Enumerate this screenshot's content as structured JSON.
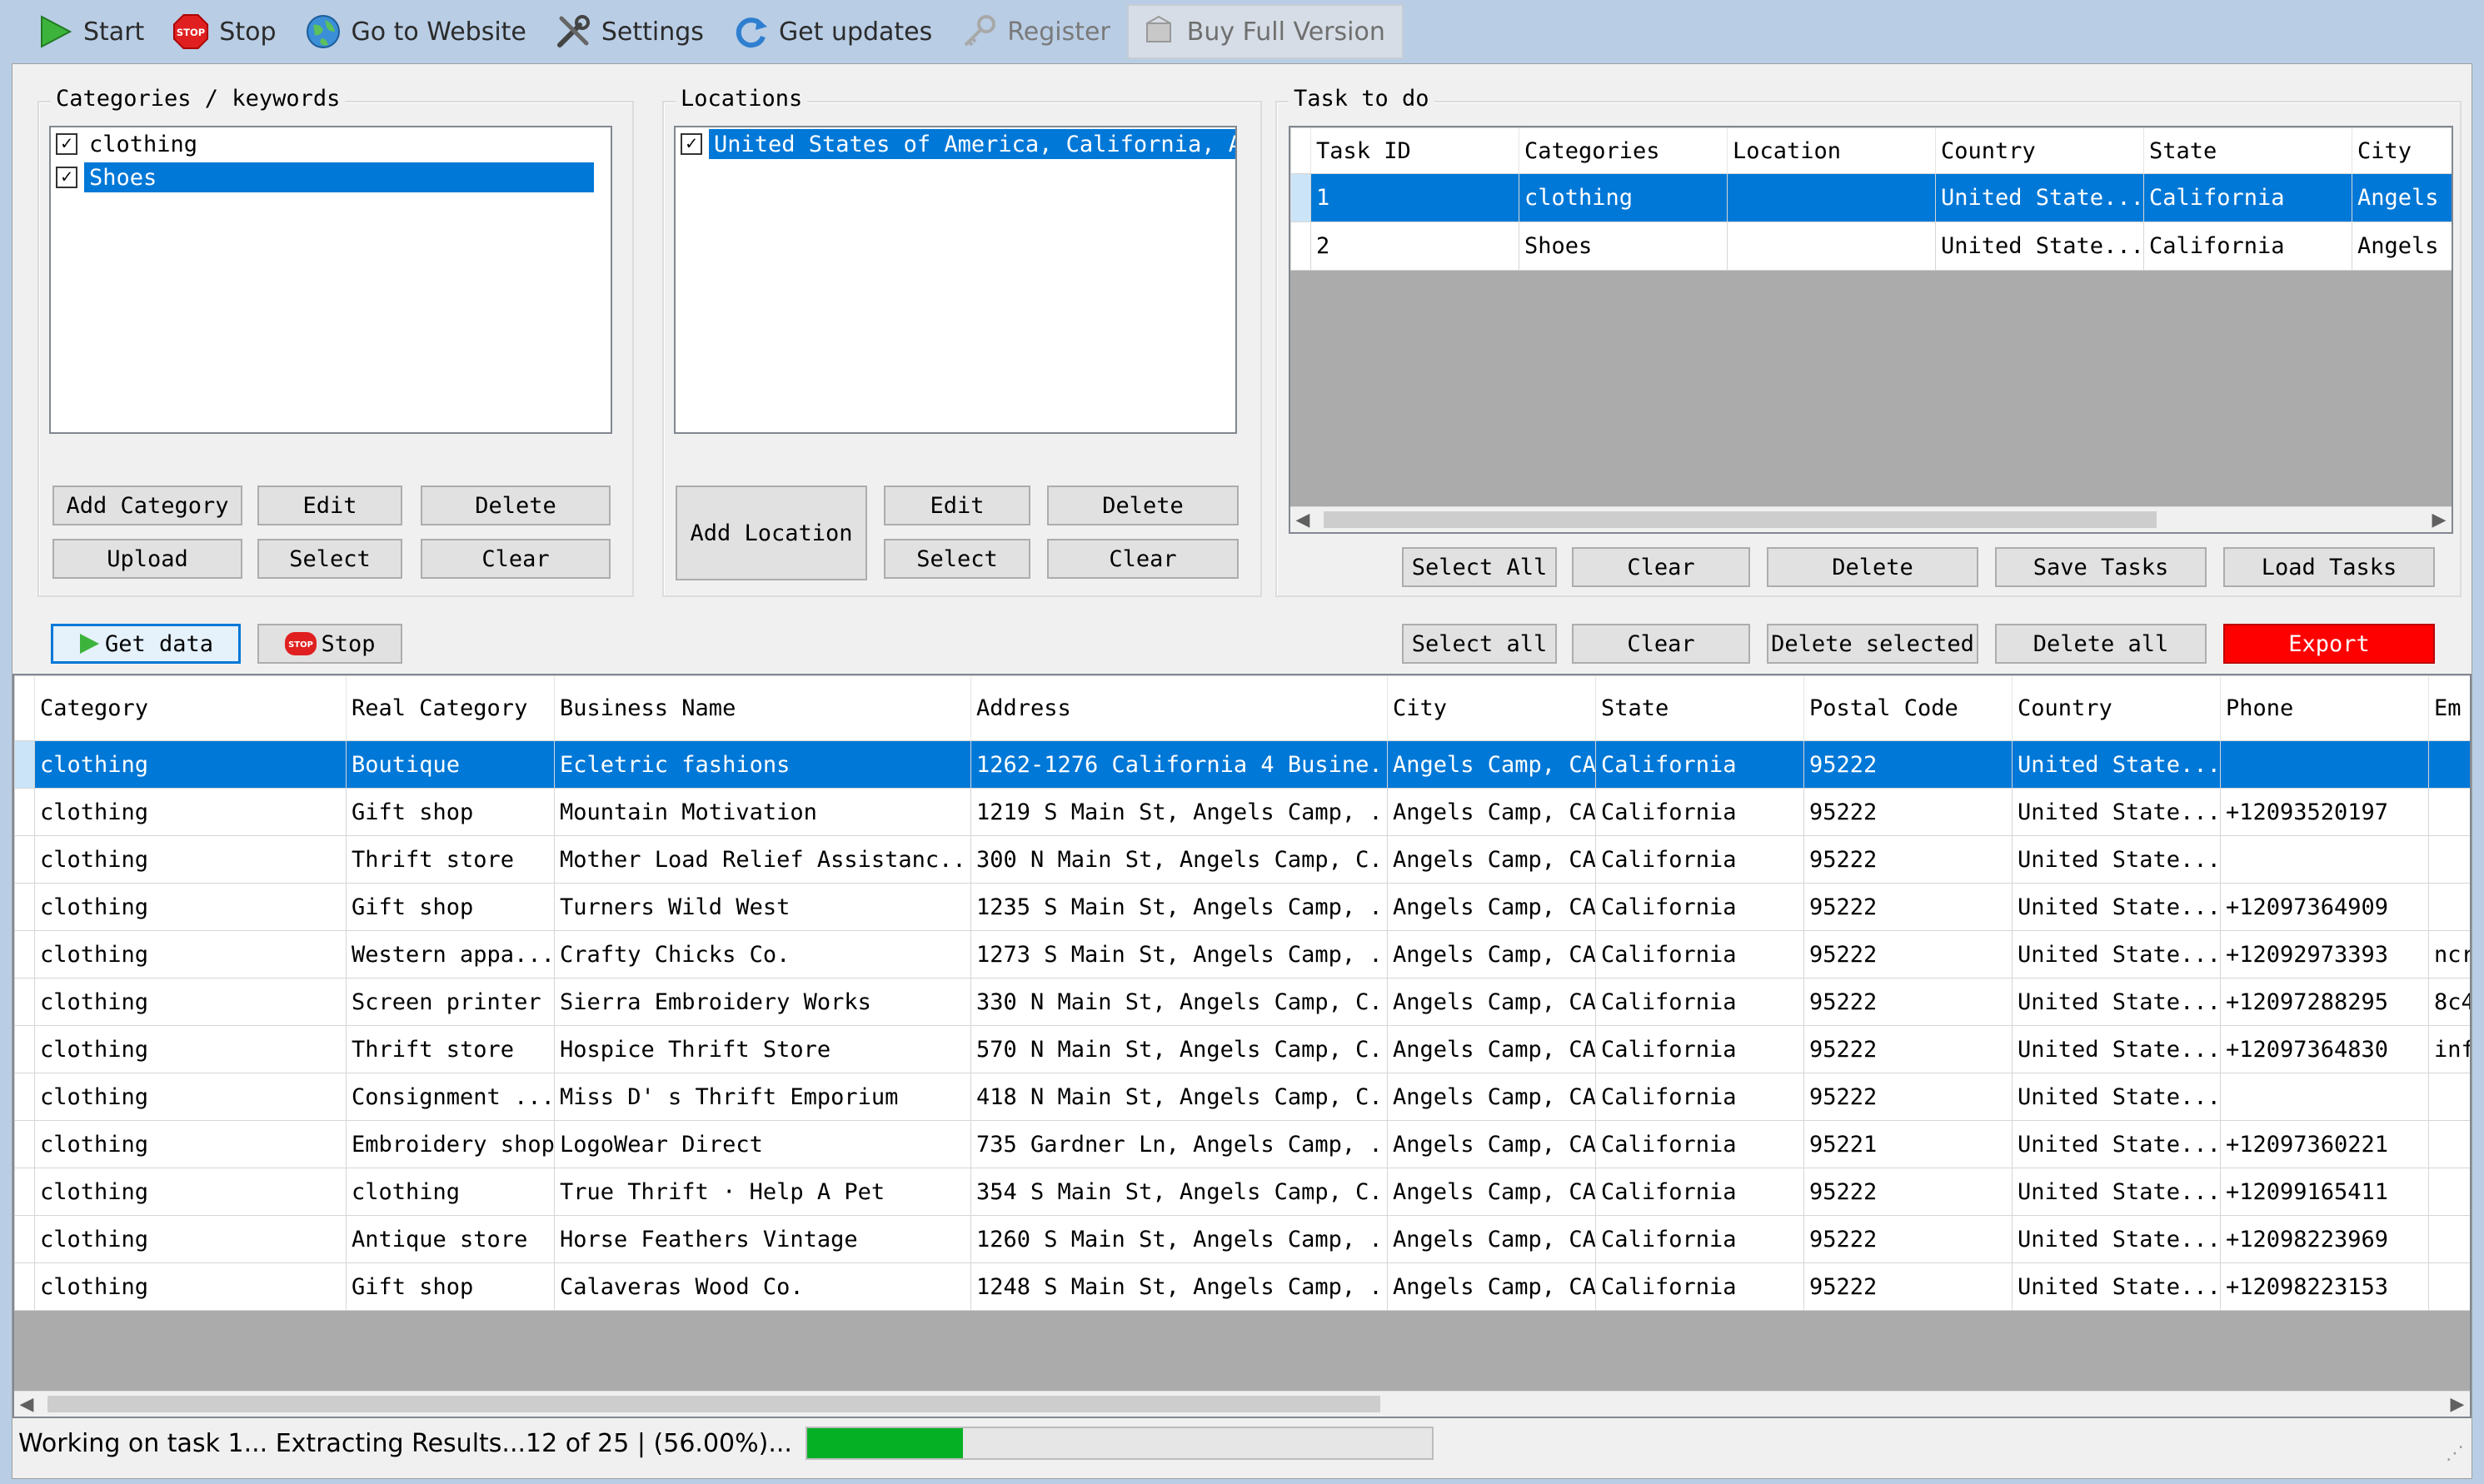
{
  "toolbar": {
    "start": "Start",
    "stop": "Stop",
    "website": "Go to Website",
    "settings": "Settings",
    "updates": "Get updates",
    "register": "Register",
    "buy": "Buy Full Version",
    "stop_badge": "STOP"
  },
  "categories": {
    "label": "Categories / keywords",
    "items": [
      {
        "label": "clothing",
        "checked": true
      },
      {
        "label": "Shoes",
        "checked": true
      }
    ],
    "add": "Add Category",
    "edit": "Edit",
    "delete": "Delete",
    "upload": "Upload",
    "select": "Select",
    "clear": "Clear"
  },
  "locations": {
    "label": "Locations",
    "items": [
      {
        "label": "United States of America, California, Ange",
        "checked": true
      }
    ],
    "add": "Add Location",
    "edit": "Edit",
    "delete": "Delete",
    "select": "Select",
    "clear": "Clear"
  },
  "tasks": {
    "label": "Task to do",
    "columns": [
      "Task ID",
      "Categories",
      "Location",
      "Country",
      "State",
      "City"
    ],
    "rows": [
      [
        "1",
        "clothing",
        "",
        "United State...",
        "California",
        "Angels"
      ],
      [
        "2",
        "Shoes",
        "",
        "United State...",
        "California",
        "Angels"
      ]
    ],
    "select_all": "Select All",
    "clear": "Clear",
    "delete": "Delete",
    "save": "Save Tasks",
    "load": "Load Tasks"
  },
  "actions": {
    "get_data": "Get data",
    "stop": "Stop",
    "select_all": "Select all",
    "clear": "Clear",
    "delete_selected": "Delete selected",
    "delete_all": "Delete all",
    "export": "Export"
  },
  "results": {
    "columns": [
      "Category",
      "Real Category",
      "Business Name",
      "Address",
      "City",
      "State",
      "Postal Code",
      "Country",
      "Phone",
      "Em"
    ],
    "rows": [
      [
        "clothing",
        "Boutique",
        "Ecletric fashions",
        "1262-1276 California 4 Busine...",
        "Angels Camp, CA",
        "California",
        "95222",
        "United State...",
        "",
        ""
      ],
      [
        "clothing",
        "Gift shop",
        "Mountain Motivation",
        "1219 S Main St, Angels Camp, ...",
        "Angels Camp, CA",
        "California",
        "95222",
        "United State...",
        "+12093520197",
        ""
      ],
      [
        "clothing",
        "Thrift store",
        "Mother Load Relief  Assistanc...",
        "300 N Main St, Angels Camp, C...",
        "Angels Camp, CA",
        "California",
        "95222",
        "United State...",
        "",
        ""
      ],
      [
        "clothing",
        "Gift shop",
        "Turners Wild West",
        "1235 S Main St, Angels Camp, ...",
        "Angels Camp, CA",
        "California",
        "95222",
        "United State...",
        "+12097364909",
        ""
      ],
      [
        "clothing",
        "Western appa...",
        "Crafty Chicks  Co.",
        "1273 S Main St, Angels Camp, ...",
        "Angels Camp, CA",
        "California",
        "95222",
        "United State...",
        "+12092973393",
        "ncr"
      ],
      [
        "clothing",
        "Screen printer",
        "Sierra Embroidery Works",
        "330 N Main St, Angels Camp, C...",
        "Angels Camp, CA",
        "California",
        "95222",
        "United State...",
        "+12097288295",
        "8c4"
      ],
      [
        "clothing",
        "Thrift store",
        "Hospice Thrift Store",
        "570 N Main St, Angels Camp, C...",
        "Angels Camp, CA",
        "California",
        "95222",
        "United State...",
        "+12097364830",
        "inf"
      ],
      [
        "clothing",
        "Consignment ...",
        "Miss D' s Thrift Emporium",
        "418 N Main St, Angels Camp, C...",
        "Angels Camp, CA",
        "California",
        "95222",
        "United State...",
        "",
        ""
      ],
      [
        "clothing",
        "Embroidery shop",
        "LogoWear Direct",
        "735 Gardner Ln, Angels Camp, ...",
        "Angels Camp, CA",
        "California",
        "95221",
        "United State...",
        "+12097360221",
        ""
      ],
      [
        "clothing",
        "clothing",
        "True Thrift · Help A Pet",
        "354 S Main St, Angels Camp, C...",
        "Angels Camp, CA",
        "California",
        "95222",
        "United State...",
        "+12099165411",
        ""
      ],
      [
        "clothing",
        "Antique store",
        "Horse Feathers Vintage",
        "1260 S Main St, Angels Camp, ...",
        "Angels Camp, CA",
        "California",
        "95222",
        "United State...",
        "+12098223969",
        ""
      ],
      [
        "clothing",
        "Gift shop",
        "Calaveras Wood Co.",
        "1248 S Main St, Angels Camp, ...",
        "Angels Camp, CA",
        "California",
        "95222",
        "United State...",
        "+12098223153",
        ""
      ]
    ]
  },
  "status": {
    "text": "Working on task 1... Extracting Results...12 of 25 | (56.00%)...",
    "progress": 0.25
  },
  "colors": {
    "selection": "#0078d7",
    "export": "#ff0000",
    "progress": "#06b025"
  }
}
